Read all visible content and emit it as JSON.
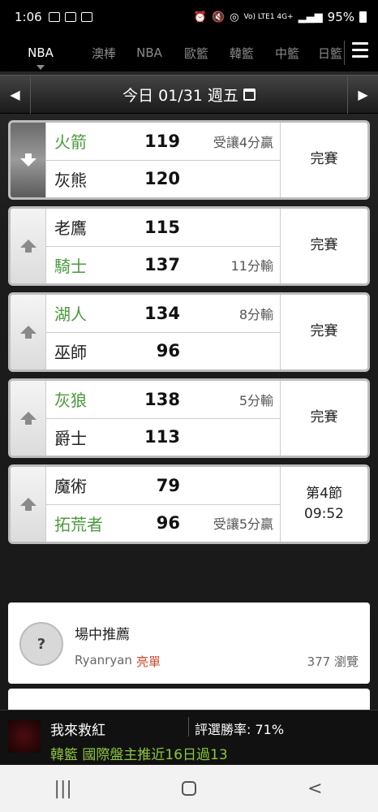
{
  "status_bar": {
    "time": "1:06",
    "network": "Vo) LTE1 4G+",
    "battery": "95%"
  },
  "tabs": [
    {
      "label": "NBA",
      "active": true
    },
    {
      "label": "澳棒",
      "active": false
    },
    {
      "label": "NBA",
      "active": false
    },
    {
      "label": "歐籃",
      "active": false
    },
    {
      "label": "韓籃",
      "active": false
    },
    {
      "label": "中籃",
      "active": false
    },
    {
      "label": "日籃",
      "active": false
    }
  ],
  "date_bar": {
    "date_text": "今日 01/31 週五"
  },
  "games": [
    {
      "away": {
        "name": "火箭",
        "score": "119",
        "note": "受讓4分贏",
        "win": true
      },
      "home": {
        "name": "灰熊",
        "score": "120",
        "note": "",
        "win": false
      },
      "state": "完賽",
      "selected": true
    },
    {
      "away": {
        "name": "老鷹",
        "score": "115",
        "note": "",
        "win": false
      },
      "home": {
        "name": "騎士",
        "score": "137",
        "note": "11分輸",
        "win": true
      },
      "state": "完賽",
      "selected": false
    },
    {
      "away": {
        "name": "湖人",
        "score": "134",
        "note": "8分輸",
        "win": true
      },
      "home": {
        "name": "巫師",
        "score": "96",
        "note": "",
        "win": false
      },
      "state": "完賽",
      "selected": false
    },
    {
      "away": {
        "name": "灰狼",
        "score": "138",
        "note": "5分輸",
        "win": true
      },
      "home": {
        "name": "爵士",
        "score": "113",
        "note": "",
        "win": false
      },
      "state": "完賽",
      "selected": false
    },
    {
      "away": {
        "name": "魔術",
        "score": "79",
        "note": "",
        "win": false
      },
      "home": {
        "name": "拓荒者",
        "score": "96",
        "note": "受讓5分贏",
        "win": true
      },
      "state": "第4節\n09:52",
      "selected": false
    }
  ],
  "recommendation": {
    "title": "場中推薦",
    "author": "Ryanryan",
    "tag": "亮單",
    "views": "377 瀏覽"
  },
  "banner": {
    "name": "我來救紅",
    "rate": "評選勝率: 71%",
    "promo": "韓籃 國際盤主推近16日過13"
  },
  "colors": {
    "win_green": "#4a9a3c",
    "tag_red": "#d0492f",
    "promo_green": "#8cc63f"
  }
}
